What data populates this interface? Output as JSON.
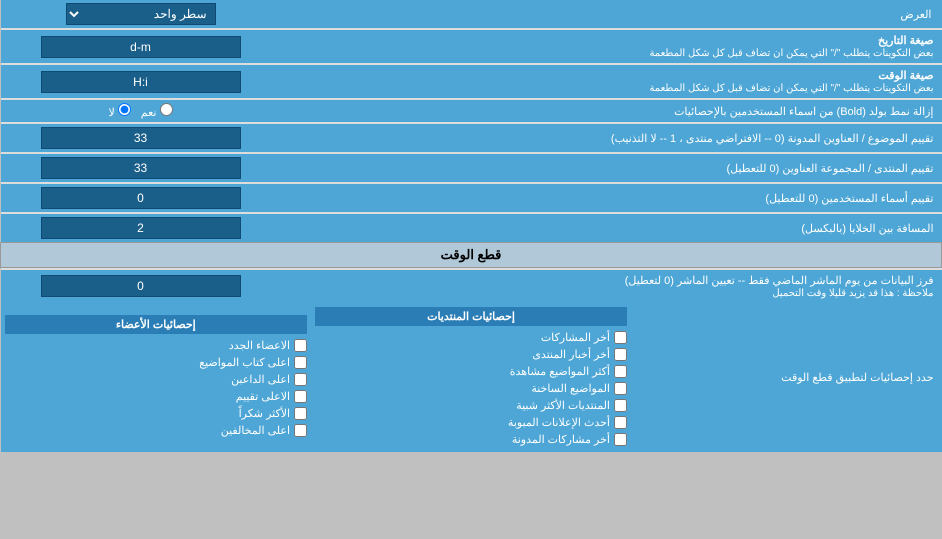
{
  "header": {
    "title": "العرض",
    "row_label": "سطر واحد"
  },
  "date_format": {
    "label": "صيغة التاريخ",
    "sublabel": "بعض التكوينات يتطلب  \"/\" التي يمكن ان تضاف قبل كل شكل المطعمة",
    "value": "d-m"
  },
  "time_format": {
    "label": "صيغة الوقت",
    "sublabel": "بعض التكوينات يتطلب  \"/\" التي يمكن ان تضاف قبل كل شكل المطعمة",
    "value": "H:i"
  },
  "bold_remove": {
    "label": "إزالة نمط بولد (Bold) من اسماء المستخدمين بالإحصائيات",
    "radio_yes": "نعم",
    "radio_no": "لا",
    "selected": "no"
  },
  "topic_order": {
    "label": "تقييم الموضوع / العناوين المدونة (0 -- الافتراضي منتدى ، 1 -- لا التذنيب)",
    "value": "33"
  },
  "forum_order": {
    "label": "تقييم المنتدى / المجموعة العناوين (0 للتعطيل)",
    "value": "33"
  },
  "user_order": {
    "label": "تقييم أسماء المستخدمين (0 للتعطيل)",
    "value": "0"
  },
  "cell_spacing": {
    "label": "المسافة بين الخلايا (بالبكسل)",
    "value": "2"
  },
  "cutoff_section": {
    "title": "قطع الوقت"
  },
  "cutoff_value": {
    "label": "فرز البيانات من يوم الماشر الماضي فقط -- تعيين الماشر (0 لتعطيل)",
    "sublabel": "ملاحظة : هذا قد يزيد قليلا وقت التحميل",
    "value": "0"
  },
  "stats_limit": {
    "label": "حدد إحصائيات لتطبيق قطع الوقت"
  },
  "stats_posts": {
    "header": "إحصائيات المنتديات",
    "items": [
      "أخر المشاركات",
      "أخر أخبار المنتدى",
      "أكثر المواضيع مشاهدة",
      "المواضيع الساخنة",
      "المنتديات الأكثر شبية",
      "أحدث الإعلانات المبوبة",
      "أخر مشاركات المدونة"
    ]
  },
  "stats_members": {
    "header": "إحصائيات الأعضاء",
    "items": [
      "الاعضاء الجدد",
      "اعلى كتاب المواضيع",
      "اعلى الداعبن",
      "الاعلى تقييم",
      "الأكثر شكراً",
      "اعلى المخالفين"
    ]
  }
}
